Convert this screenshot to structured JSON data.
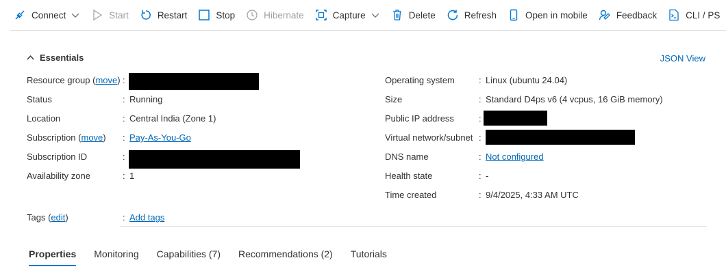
{
  "toolbar": {
    "connect": "Connect",
    "start": "Start",
    "restart": "Restart",
    "stop": "Stop",
    "hibernate": "Hibernate",
    "capture": "Capture",
    "delete": "Delete",
    "refresh": "Refresh",
    "open_mobile": "Open in mobile",
    "feedback": "Feedback",
    "cli": "CLI / PS"
  },
  "essentials": {
    "title": "Essentials",
    "json_view": "JSON View",
    "left": {
      "resource_group_label": "Resource group",
      "resource_group_link": "move",
      "status_label": "Status",
      "status_value": "Running",
      "location_label": "Location",
      "location_value": "Central India (Zone 1)",
      "subscription_label": "Subscription",
      "subscription_link": "move",
      "subscription_value": "Pay-As-You-Go",
      "subscription_id_label": "Subscription ID",
      "availability_zone_label": "Availability zone",
      "availability_zone_value": "1"
    },
    "right": {
      "os_label": "Operating system",
      "os_value": "Linux (ubuntu 24.04)",
      "size_label": "Size",
      "size_value": "Standard D4ps v6 (4 vcpus, 16 GiB memory)",
      "public_ip_label": "Public IP address",
      "vnet_label": "Virtual network/subnet",
      "dns_label": "DNS name",
      "dns_value": "Not configured",
      "health_label": "Health state",
      "health_value": "-",
      "time_created_label": "Time created",
      "time_created_value": "9/4/2025, 4:33 AM UTC"
    },
    "tags_label": "Tags",
    "tags_link": "edit",
    "add_tags": "Add tags"
  },
  "tabs": [
    "Properties",
    "Monitoring",
    "Capabilities (7)",
    "Recommendations (2)",
    "Tutorials"
  ],
  "colors": {
    "link": "#0067b8",
    "accent": "#0078d4"
  }
}
